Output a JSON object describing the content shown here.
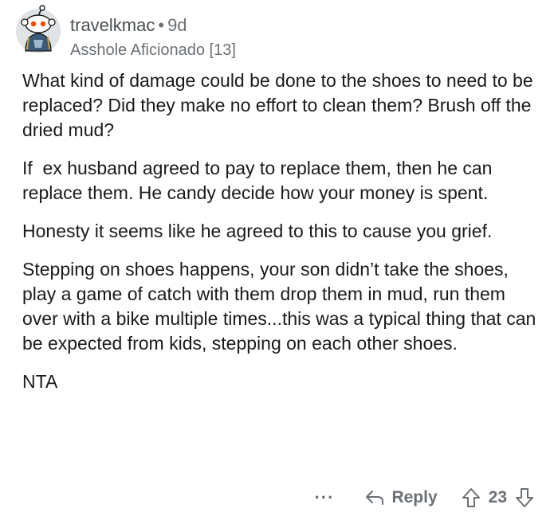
{
  "comment": {
    "username": "travelkmac",
    "separator": "•",
    "age": "9d",
    "flair": "Asshole Aficionado [13]",
    "paragraphs": [
      "What kind of damage could be done to the shoes to need to be replaced? Did they make no effort to clean them? Brush off the dried mud?",
      "If  ex husband agreed to pay to replace them, then he can replace them. He candy decide how your money is spent.",
      "Honesty it seems like he agreed to this to cause you grief.",
      "Stepping on shoes happens, your son didn’t take the shoes, play a game of catch with them drop them in mud, run them over with a bike multiple times...this was a typical thing that can be expected from kids, stepping on each other shoes.",
      "NTA"
    ]
  },
  "actions": {
    "more_label": "···",
    "reply_label": "Reply",
    "score": "23"
  },
  "icons": {
    "avatar": "snoo-avatar-icon",
    "reply": "reply-arrow-icon",
    "upvote": "upvote-arrow-icon",
    "downvote": "downvote-arrow-icon"
  },
  "colors": {
    "meta_text": "#6b7075",
    "body_text": "#1a1a1b"
  }
}
